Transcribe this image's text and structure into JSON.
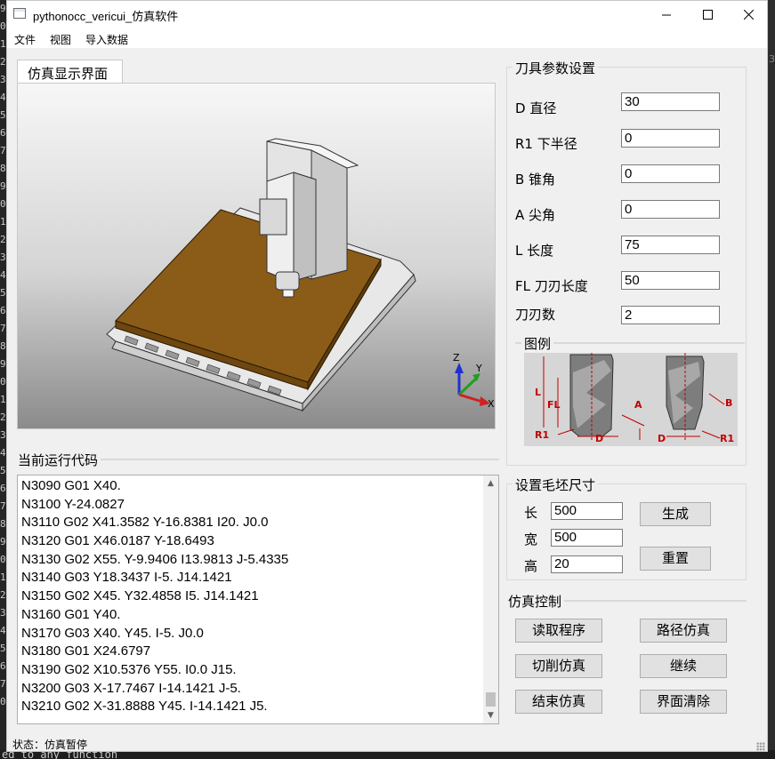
{
  "window": {
    "title": "pythonocc_vericui_仿真软件",
    "controls": {
      "minimize": "—",
      "maximize": "☐",
      "close": "✕"
    }
  },
  "menu": [
    "文件",
    "视图",
    "导入数据"
  ],
  "viewer": {
    "tab_label": "仿真显示界面",
    "axes": {
      "z": "Z",
      "y": "Y",
      "x": "X"
    }
  },
  "code_panel": {
    "title": "当前运行代码",
    "lines": [
      "N3090 G01 X40.",
      "N3100 Y-24.0827",
      "N3110 G02 X41.3582 Y-16.8381 I20. J0.0",
      "N3120 G01 X46.0187 Y-18.6493",
      "N3130 G02 X55. Y-9.9406 I13.9813 J-5.4335",
      "N3140 G03 Y18.3437 I-5. J14.1421",
      "N3150 G02 X45. Y32.4858 I5. J14.1421",
      "N3160 G01 Y40.",
      "N3170 G03 X40. Y45. I-5. J0.0",
      "N3180 G01 X24.6797",
      "N3190 G02 X10.5376 Y55. I0.0 J15.",
      "N3200 G03 X-17.7467 I-14.1421 J-5.",
      "N3210 G02 X-31.8888 Y45. I-14.1421 J5."
    ]
  },
  "tool_params": {
    "title": "刀具参数设置",
    "fields": [
      {
        "label": "D 直径",
        "value": "30"
      },
      {
        "label": "R1 下半径",
        "value": "0"
      },
      {
        "label": "B 锥角",
        "value": "0"
      },
      {
        "label": "A 尖角",
        "value": "0"
      },
      {
        "label": "L 长度",
        "value": "75"
      },
      {
        "label": "FL 刀刃长度",
        "value": "50"
      },
      {
        "label": "刀刃数",
        "value": "2"
      }
    ]
  },
  "legend": {
    "title": "图例",
    "labels": {
      "L": "L",
      "FL": "FL",
      "R1_left": "R1",
      "D_left": "D",
      "A": "A",
      "B": "B",
      "D_right": "D",
      "R1_right": "R1"
    }
  },
  "blank_size": {
    "title": "设置毛坯尺寸",
    "fields": [
      {
        "label": "长",
        "value": "500"
      },
      {
        "label": "宽",
        "value": "500"
      },
      {
        "label": "高",
        "value": "20"
      }
    ],
    "generate_label": "生成",
    "reset_label": "重置"
  },
  "sim_control": {
    "title": "仿真控制",
    "buttons": {
      "read_program": "读取程序",
      "path_sim": "路径仿真",
      "cut_sim": "切削仿真",
      "continue": "继续",
      "end_sim": "结束仿真",
      "clear": "界面清除"
    }
  },
  "status": {
    "text": "状态：仿真暂停"
  },
  "background": {
    "gutter": [
      "9",
      "0",
      "1",
      "2",
      "3",
      "4",
      "5",
      "6",
      "7",
      "8",
      "9",
      "0",
      "1",
      "2",
      "3",
      "4",
      "5",
      "6",
      "7",
      "8",
      "9",
      "0",
      "1",
      "2",
      "3",
      "4",
      "5",
      "6",
      "7",
      "8",
      "9",
      "0",
      "1",
      "2",
      "3",
      "4",
      "5",
      "6",
      "7",
      "0"
    ],
    "right_number": "3",
    "terminal_text": "ed to any function"
  },
  "colors": {
    "plate": "#8a5c18",
    "legend_red": "#c00000",
    "axis_x": "#d02020",
    "axis_y": "#20a020",
    "axis_z": "#2030d0"
  }
}
